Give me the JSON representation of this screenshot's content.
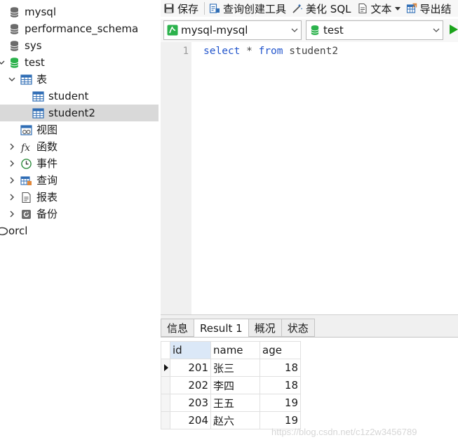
{
  "tree": {
    "items": [
      {
        "label": "mysql",
        "icon": "database-icon"
      },
      {
        "label": "performance_schema",
        "icon": "database-icon"
      },
      {
        "label": "sys",
        "icon": "database-icon"
      },
      {
        "label": "test",
        "icon": "database-open-icon"
      },
      {
        "label": "表",
        "icon": "tables-icon"
      },
      {
        "label": "student",
        "icon": "table-icon"
      },
      {
        "label": "student2",
        "icon": "table-icon",
        "selected": true
      },
      {
        "label": "视图",
        "icon": "view-icon"
      },
      {
        "label": "函数",
        "icon": "function-icon"
      },
      {
        "label": "事件",
        "icon": "event-icon"
      },
      {
        "label": "查询",
        "icon": "query-icon"
      },
      {
        "label": "报表",
        "icon": "report-icon"
      },
      {
        "label": "备份",
        "icon": "backup-icon"
      },
      {
        "label": "orcl",
        "icon": "connection-icon"
      }
    ]
  },
  "toolbar": {
    "save": "保存",
    "query_builder": "查询创建工具",
    "beautify_sql": "美化 SQL",
    "text": "文本",
    "export_result": "导出结"
  },
  "selectors": {
    "connection": "mysql-mysql",
    "database": "test"
  },
  "editor": {
    "line_number": "1",
    "kw_select": "select",
    "star": " * ",
    "kw_from": "from",
    "table": " student2"
  },
  "bottom": {
    "tabs": [
      "信息",
      "Result 1",
      "概况",
      "状态"
    ],
    "active_tab": "Result 1",
    "columns": [
      "id",
      "name",
      "age"
    ],
    "rows": [
      [
        "201",
        "张三",
        "18"
      ],
      [
        "202",
        "李四",
        "18"
      ],
      [
        "203",
        "王五",
        "19"
      ],
      [
        "204",
        "赵六",
        "19"
      ]
    ]
  },
  "watermark": "https://blog.csdn.net/c1z2w3456789",
  "colors": {
    "keyword": "#2255cc",
    "selection": "#d9d9d9",
    "database_active": "#2bb24c",
    "run": "#1aa31a"
  }
}
